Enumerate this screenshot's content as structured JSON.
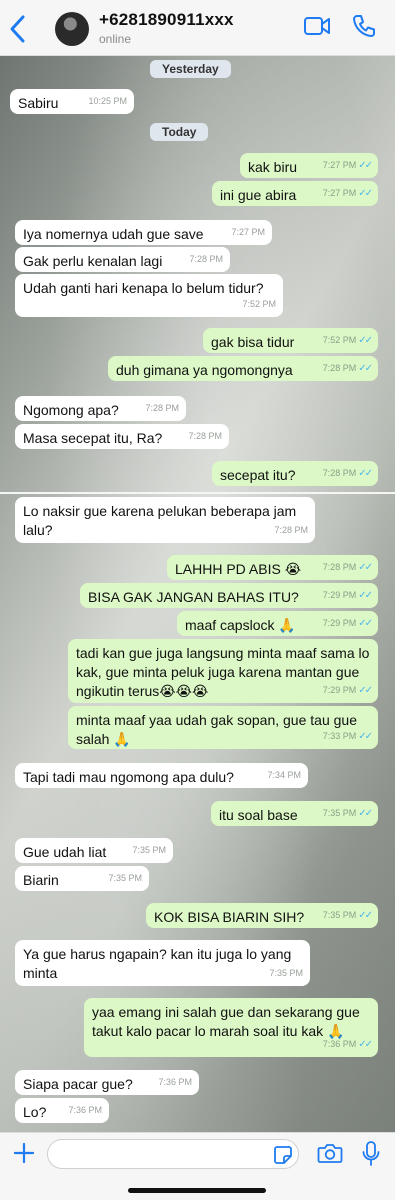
{
  "contact": {
    "name": "+6281890911xxx",
    "status": "online"
  },
  "colors": {
    "accent": "#1f7bf2",
    "outgoing": "#dcf8c6",
    "incoming": "#ffffff",
    "read_ticks": "#4fb6ec"
  },
  "icons": {
    "back": "chevron-left-icon",
    "video": "video-call-icon",
    "call": "phone-icon",
    "plus": "plus-icon",
    "sticker": "sticker-icon",
    "camera": "camera-icon",
    "mic": "microphone-icon"
  },
  "date_pills": [
    "Yesterday",
    "Today"
  ],
  "messages": [
    {
      "dir": "in",
      "text": "Sabiru",
      "time": "10:25 PM"
    },
    {
      "dir": "out",
      "text": "kak biru",
      "time": "7:27 PM",
      "read": true
    },
    {
      "dir": "out",
      "text": "ini gue abira",
      "time": "7:27 PM",
      "read": true
    },
    {
      "dir": "in",
      "text": "Iya nomernya udah gue save",
      "time": "7:27 PM"
    },
    {
      "dir": "in",
      "text": "Gak perlu kenalan lagi",
      "time": "7:28 PM"
    },
    {
      "dir": "in",
      "text": "Udah ganti hari kenapa lo belum tidur?",
      "time": "7:52 PM"
    },
    {
      "dir": "out",
      "text": "gak bisa tidur",
      "time": "7:52 PM",
      "read": true
    },
    {
      "dir": "out",
      "text": "duh gimana ya ngomongnya",
      "time": "7:28 PM",
      "read": true
    },
    {
      "dir": "in",
      "text": "Ngomong apa?",
      "time": "7:28 PM"
    },
    {
      "dir": "in",
      "text": "Masa secepat itu, Ra?",
      "time": "7:28 PM"
    },
    {
      "dir": "out",
      "text": "secepat itu?",
      "time": "7:28 PM",
      "read": true
    },
    {
      "dir": "in",
      "text": "Lo naksir gue karena pelukan beberapa jam lalu?",
      "time": "7:28 PM"
    },
    {
      "dir": "out",
      "text": "LAHHH PD ABIS 😭",
      "time": "7:28 PM",
      "read": true
    },
    {
      "dir": "out",
      "text": "BISA GAK JANGAN BAHAS ITU?",
      "time": "7:29 PM",
      "read": true
    },
    {
      "dir": "out",
      "text": "maaf capslock 🙏",
      "time": "7:29 PM",
      "read": true
    },
    {
      "dir": "out",
      "text": "tadi kan gue juga langsung minta maaf sama lo kak, gue minta peluk juga karena mantan gue ngikutin terus😭😭😭",
      "time": "7:29 PM",
      "read": true
    },
    {
      "dir": "out",
      "text": "minta maaf yaa udah gak sopan, gue tau gue salah 🙏",
      "time": "7:33 PM",
      "read": true
    },
    {
      "dir": "in",
      "text": "Tapi tadi mau ngomong apa dulu?",
      "time": "7:34 PM"
    },
    {
      "dir": "out",
      "text": "itu soal base",
      "time": "7:35 PM",
      "read": true
    },
    {
      "dir": "in",
      "text": "Gue udah liat",
      "time": "7:35 PM"
    },
    {
      "dir": "in",
      "text": "Biarin",
      "time": "7:35 PM"
    },
    {
      "dir": "out",
      "text": "KOK BISA BIARIN SIH?",
      "time": "7:35 PM",
      "read": true
    },
    {
      "dir": "in",
      "text": "Ya gue harus ngapain? kan itu juga lo yang minta",
      "time": "7:35 PM"
    },
    {
      "dir": "out",
      "text": "yaa emang ini salah gue dan sekarang gue takut kalo pacar lo marah soal itu kak 🙏",
      "time": "7:36 PM",
      "read": true
    },
    {
      "dir": "in",
      "text": "Siapa pacar gue?",
      "time": "7:36 PM"
    },
    {
      "dir": "in",
      "text": "Lo?",
      "time": "7:36 PM"
    }
  ],
  "composer": {
    "value": "",
    "placeholder": ""
  }
}
